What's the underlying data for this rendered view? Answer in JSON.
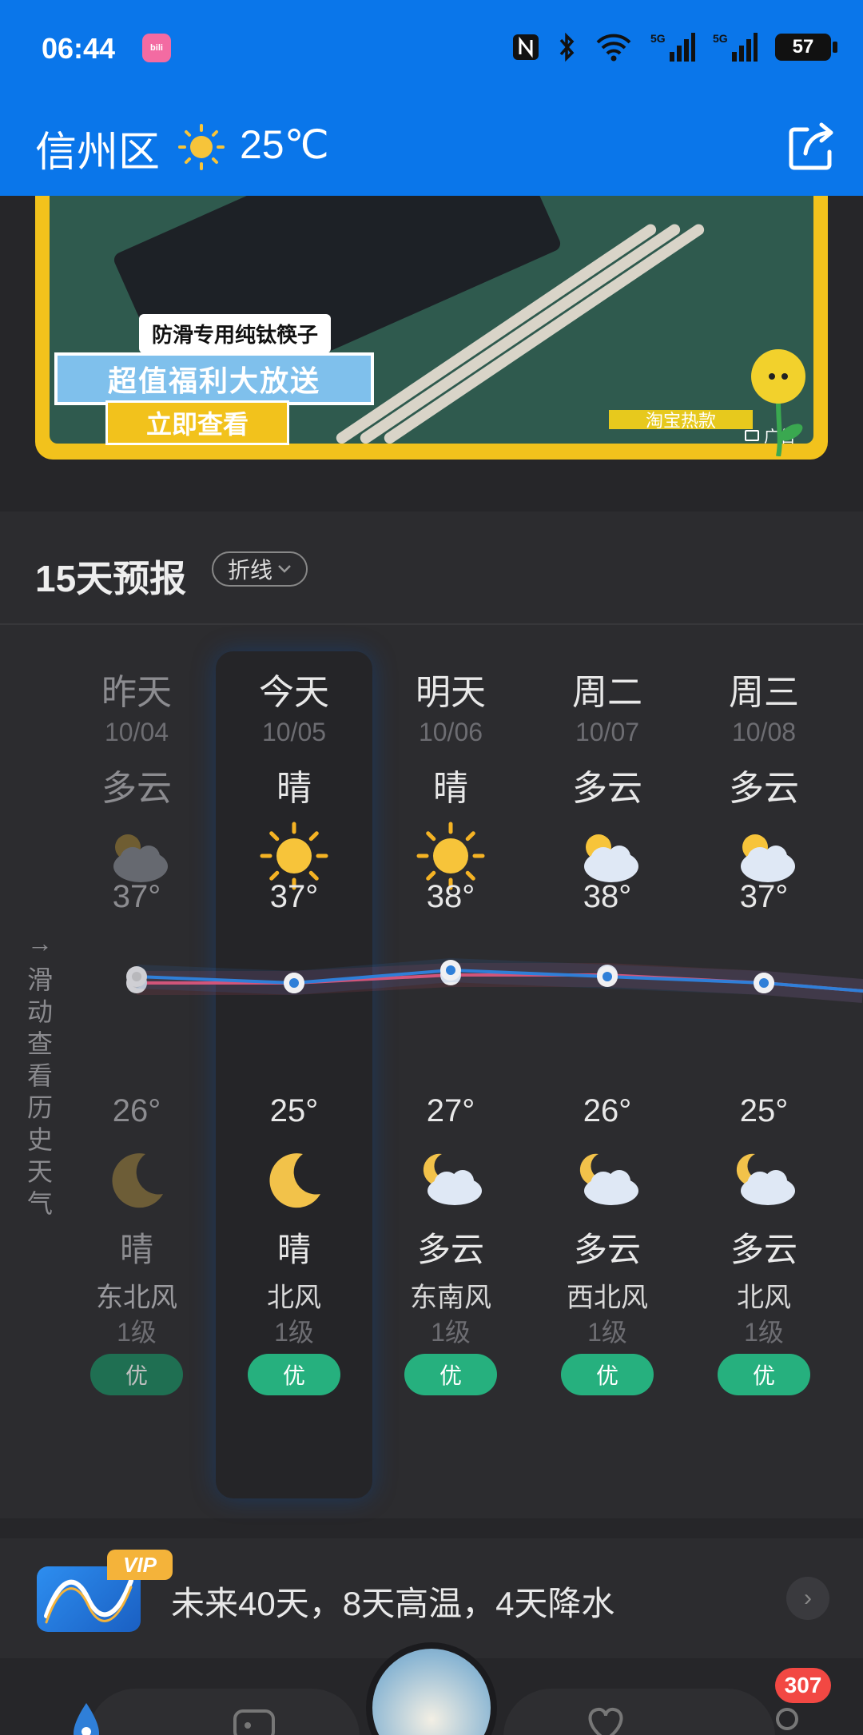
{
  "status_bar": {
    "time": "06:44",
    "app_badge": "bilibili",
    "battery": "57"
  },
  "header": {
    "location": "信州区",
    "temperature": "25℃",
    "weather_icon": "sun-icon",
    "share_icon": "share-icon"
  },
  "ad": {
    "badge_text": "防滑专用纯钛筷子",
    "banner_text": "超值福利大放送",
    "cta_label": "立即查看",
    "shop_text": "淘宝热款",
    "ad_label": "广告"
  },
  "forecast": {
    "title": "15天预报",
    "mode_label": "折线",
    "side_hint": "滑动查看历史天气",
    "days": [
      {
        "name": "昨天",
        "date": "10/04",
        "day_condition": "多云",
        "day_icon": "partly-cloudy-icon",
        "high": "37°",
        "low": "26°",
        "night_icon": "moon-icon",
        "night_condition": "晴",
        "wind": "东北风",
        "wind_level": "1级",
        "aqi": "优"
      },
      {
        "name": "今天",
        "date": "10/05",
        "day_condition": "晴",
        "day_icon": "sun-icon",
        "high": "37°",
        "low": "25°",
        "night_icon": "moon-icon",
        "night_condition": "晴",
        "wind": "北风",
        "wind_level": "1级",
        "aqi": "优"
      },
      {
        "name": "明天",
        "date": "10/06",
        "day_condition": "晴",
        "day_icon": "sun-icon",
        "high": "38°",
        "low": "27°",
        "night_icon": "cloudy-night-icon",
        "night_condition": "多云",
        "wind": "东南风",
        "wind_level": "1级",
        "aqi": "优"
      },
      {
        "name": "周二",
        "date": "10/07",
        "day_condition": "多云",
        "day_icon": "partly-cloudy-icon",
        "high": "38°",
        "low": "26°",
        "night_icon": "cloudy-night-icon",
        "night_condition": "多云",
        "wind": "西北风",
        "wind_level": "1级",
        "aqi": "优"
      },
      {
        "name": "周三",
        "date": "10/08",
        "day_condition": "多云",
        "day_icon": "partly-cloudy-icon",
        "high": "37°",
        "low": "25°",
        "night_icon": "cloudy-night-icon",
        "night_condition": "多云",
        "wind": "北风",
        "wind_level": "1级",
        "aqi": "优"
      }
    ],
    "colors": {
      "high_line": "#e8506e",
      "low_line": "#2f7fd8",
      "aqi_good": "#26b07e"
    }
  },
  "chart_data": {
    "type": "line",
    "categories": [
      "10/04",
      "10/05",
      "10/06",
      "10/07",
      "10/08"
    ],
    "series": [
      {
        "values": [
          37,
          37,
          38,
          38,
          37
        ]
      },
      {
        "values": [
          26,
          25,
          27,
          26,
          25
        ]
      }
    ]
  },
  "vip": {
    "tag": "VIP",
    "text": "未来40天，8天高温，4天降水"
  },
  "bottom_nav": {
    "badge_count": "307"
  }
}
